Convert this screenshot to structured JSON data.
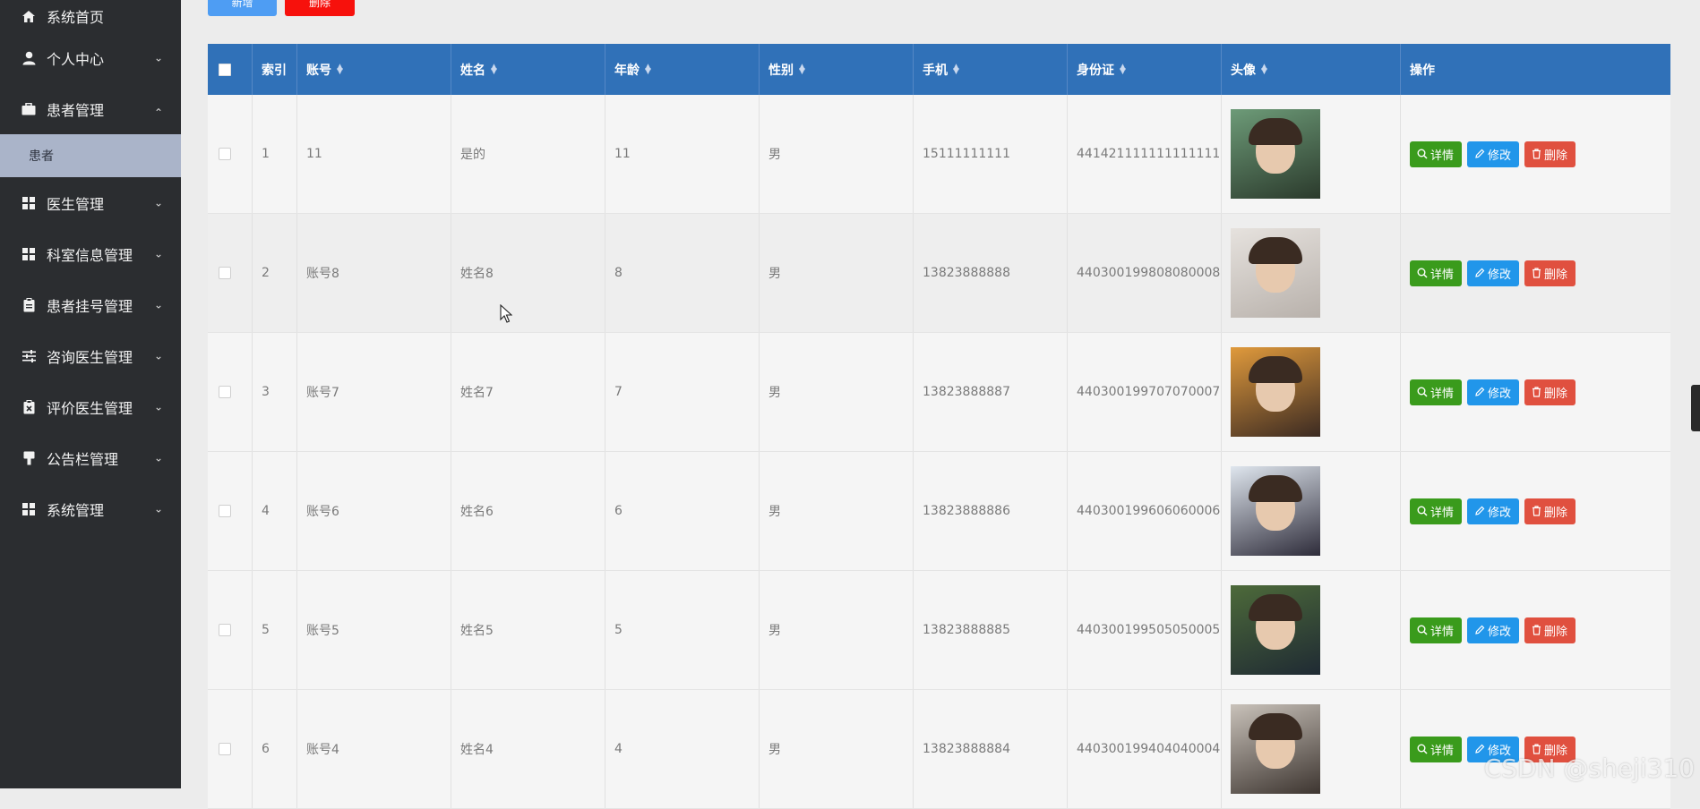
{
  "sidebar": {
    "items": [
      {
        "label": "系统首页",
        "icon": "home-icon",
        "chevron": false
      },
      {
        "label": "个人中心",
        "icon": "user-icon",
        "chevron": "down"
      },
      {
        "label": "患者管理",
        "icon": "briefcase-icon",
        "chevron": "up"
      },
      {
        "label": "医生管理",
        "icon": "grid-icon",
        "chevron": "down"
      },
      {
        "label": "科室信息管理",
        "icon": "grid-icon",
        "chevron": "down"
      },
      {
        "label": "患者挂号管理",
        "icon": "clipboard-icon",
        "chevron": "down"
      },
      {
        "label": "咨询医生管理",
        "icon": "sliders-icon",
        "chevron": "down"
      },
      {
        "label": "评价医生管理",
        "icon": "clipboard-x-icon",
        "chevron": "down"
      },
      {
        "label": "公告栏管理",
        "icon": "tag-icon",
        "chevron": "down"
      },
      {
        "label": "系统管理",
        "icon": "grid-icon",
        "chevron": "down"
      }
    ],
    "sub_item": "患者"
  },
  "toolbar": {
    "add_label": "新增",
    "delete_label": "删除"
  },
  "table": {
    "headers": [
      "索引",
      "账号",
      "姓名",
      "年龄",
      "性别",
      "手机",
      "身份证",
      "头像",
      "操作"
    ],
    "rows": [
      {
        "index": "1",
        "account": "11",
        "name": "是的",
        "age": "11",
        "gender": "男",
        "phone": "15111111111",
        "id_card": "441421111111111111"
      },
      {
        "index": "2",
        "account": "账号8",
        "name": "姓名8",
        "age": "8",
        "gender": "男",
        "phone": "13823888888",
        "id_card": "440300199808080008"
      },
      {
        "index": "3",
        "account": "账号7",
        "name": "姓名7",
        "age": "7",
        "gender": "男",
        "phone": "13823888887",
        "id_card": "440300199707070007"
      },
      {
        "index": "4",
        "account": "账号6",
        "name": "姓名6",
        "age": "6",
        "gender": "男",
        "phone": "13823888886",
        "id_card": "440300199606060006"
      },
      {
        "index": "5",
        "account": "账号5",
        "name": "姓名5",
        "age": "5",
        "gender": "男",
        "phone": "13823888885",
        "id_card": "440300199505050005"
      },
      {
        "index": "6",
        "account": "账号4",
        "name": "姓名4",
        "age": "4",
        "gender": "男",
        "phone": "13823888884",
        "id_card": "440300199404040004"
      }
    ],
    "actions": {
      "detail": "详情",
      "edit": "修改",
      "delete": "删除"
    }
  },
  "colors": {
    "header_bg": "#3071b8",
    "sidebar_bg": "#2b2d30",
    "detail": "#3a9b1c",
    "edit": "#2196ea",
    "delete": "#e0503f"
  },
  "watermark": "CSDN @sheji310"
}
